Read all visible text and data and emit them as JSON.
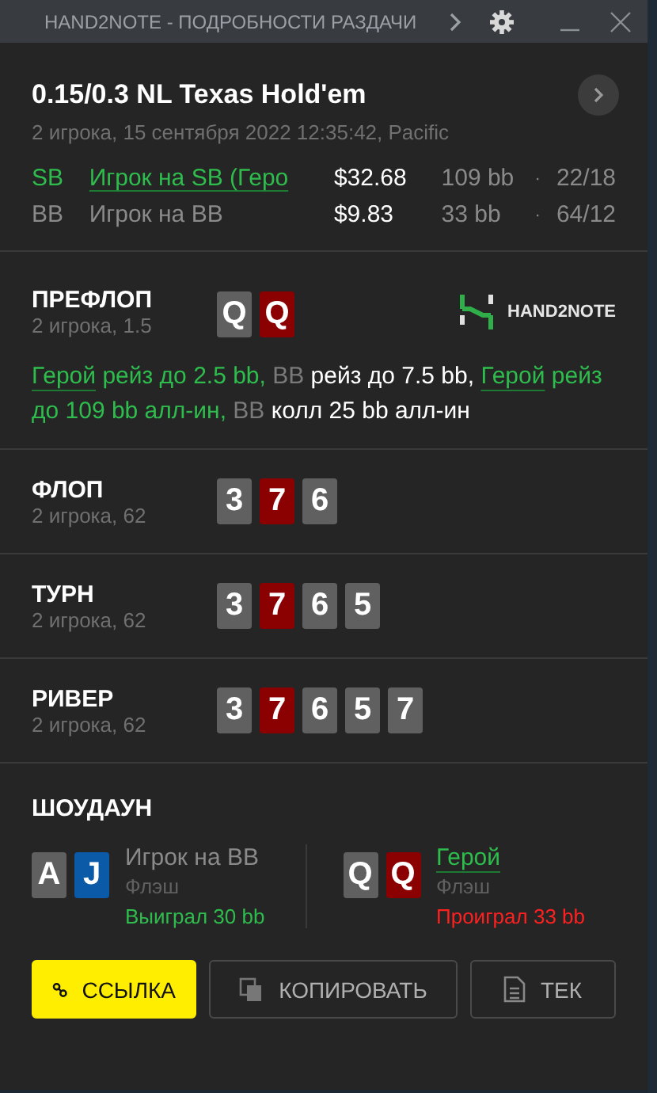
{
  "window": {
    "title": "HAND2NOTE - ПОДРОБНОСТИ РАЗДАЧИ"
  },
  "header": {
    "title": "0.15/0.3 NL Texas Hold'em",
    "subtitle": "2 игрока, 15 сентября 2022 12:35:42, Pacific",
    "players": [
      {
        "position": "SB",
        "name": "Игрок на SB (Геро",
        "hero": true,
        "stack": "$32.68",
        "bb": "109 bb",
        "separator": "·",
        "stats": "22/18"
      },
      {
        "position": "BB",
        "name": "Игрок на BB",
        "hero": false,
        "stack": "$9.83",
        "bb": "33 bb",
        "separator": "·",
        "stats": "64/12"
      }
    ]
  },
  "preflop": {
    "title": "ПРЕФЛОП",
    "subtitle": "2 игрока, 1.5",
    "logo": "HAND2NOTE",
    "cards": [
      {
        "rank": "Q",
        "color": "#606060"
      },
      {
        "rank": "Q",
        "color": "#8b0000"
      }
    ],
    "actions": [
      {
        "text": "Герой",
        "kind": "hero-name"
      },
      {
        "text": " рейз до 2.5 bb, ",
        "kind": "hero-action"
      },
      {
        "text": "BB",
        "kind": "villain-name"
      },
      {
        "text": " рейз до 7.5 bb, ",
        "kind": "villain-action"
      },
      {
        "text": "Герой",
        "kind": "hero-name"
      },
      {
        "text": " рейз до 109 bb алл-ин, ",
        "kind": "hero-action"
      },
      {
        "text": "BB",
        "kind": "villain-name"
      },
      {
        "text": " колл 25 bb алл-ин",
        "kind": "villain-action"
      }
    ]
  },
  "streets": [
    {
      "title": "ФЛОП",
      "subtitle": "2 игрока, 62",
      "cards": [
        {
          "rank": "3",
          "color": "#606060"
        },
        {
          "rank": "7",
          "color": "#8b0000"
        },
        {
          "rank": "6",
          "color": "#606060"
        }
      ]
    },
    {
      "title": "ТУРН",
      "subtitle": "2 игрока, 62",
      "cards": [
        {
          "rank": "3",
          "color": "#606060"
        },
        {
          "rank": "7",
          "color": "#8b0000"
        },
        {
          "rank": "6",
          "color": "#606060"
        },
        {
          "rank": "5",
          "color": "#606060"
        }
      ]
    },
    {
      "title": "РИВЕР",
      "subtitle": "2 игрока, 62",
      "cards": [
        {
          "rank": "3",
          "color": "#606060"
        },
        {
          "rank": "7",
          "color": "#8b0000"
        },
        {
          "rank": "6",
          "color": "#606060"
        },
        {
          "rank": "5",
          "color": "#606060"
        },
        {
          "rank": "7",
          "color": "#606060"
        }
      ]
    }
  ],
  "showdown": {
    "title": "ШОУДАУН",
    "hands": [
      {
        "name": "Игрок на BB",
        "hero": false,
        "combo": "Флэш",
        "result": "Выиграл 30 bb",
        "won": true,
        "cards": [
          {
            "rank": "A",
            "color": "#606060"
          },
          {
            "rank": "J",
            "color": "#0b5aa8"
          }
        ]
      },
      {
        "name": "Герой",
        "hero": true,
        "combo": "Флэш",
        "result": "Проиграл 33 bb",
        "won": false,
        "cards": [
          {
            "rank": "Q",
            "color": "#606060"
          },
          {
            "rank": "Q",
            "color": "#8b0000"
          }
        ]
      }
    ]
  },
  "buttons": [
    {
      "label": "ССЫЛКА",
      "kind": "link"
    },
    {
      "label": "КОПИРОВАТЬ",
      "kind": "copy"
    },
    {
      "label": "ТЕК",
      "kind": "text"
    }
  ]
}
